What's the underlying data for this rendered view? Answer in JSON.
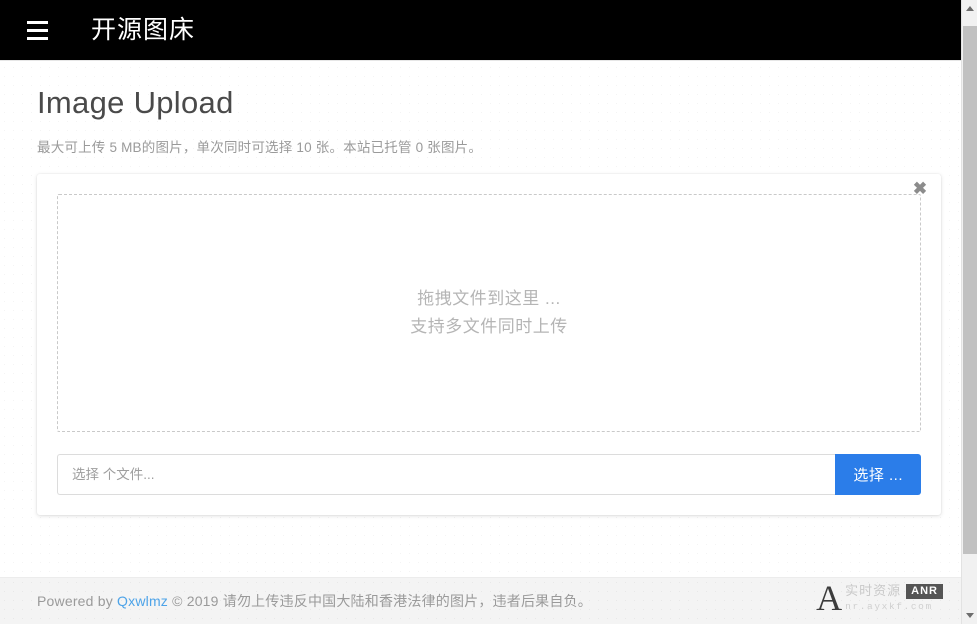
{
  "header": {
    "menu_icon": "hamburger-menu-icon",
    "brand": "开源图床"
  },
  "main": {
    "title": "Image Upload",
    "description": "最大可上传 5 MB的图片，单次同时可选择 10 张。本站已托管 0 张图片。",
    "card": {
      "close_label": "✖",
      "dropzone": {
        "line1": "拖拽文件到这里 ...",
        "line2": "支持多文件同时上传"
      },
      "file_input_placeholder": "选择 个文件...",
      "file_input_value": "",
      "choose_button": "选择 ..."
    }
  },
  "footer": {
    "prefix": "Powered by ",
    "link": "Qxwlmz",
    "suffix": " © 2019 请勿上传违反中国大陆和香港法律的图片，违者后果自负。"
  },
  "watermark": {
    "logo": "A",
    "cn_text": "实时资源",
    "badge": "ANR",
    "url": "nr.ayxkf.com"
  },
  "colors": {
    "appbar_bg": "#000000",
    "accent_blue": "#2b7de9",
    "link_blue": "#4da3e8",
    "title_gray": "#4a4a4a",
    "muted_gray": "#9a9a9a",
    "dropzone_text": "#b5b5b5",
    "page_bg": "#ffffff",
    "footer_bg": "#f4f4f4"
  }
}
